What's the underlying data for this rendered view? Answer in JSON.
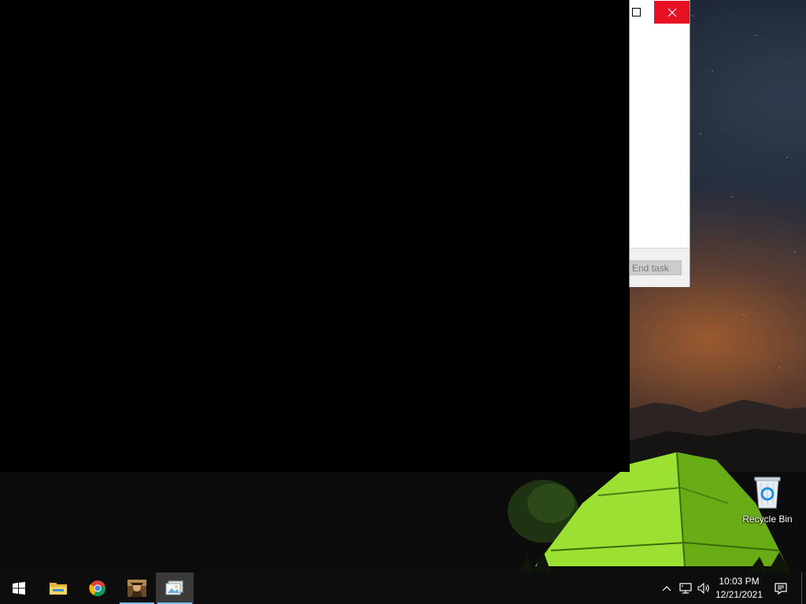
{
  "window": {
    "maximize_label": "Maximize",
    "close_label": "Close",
    "end_task_label": "End task"
  },
  "desktop": {
    "recycle_bin_label": "Recycle Bin"
  },
  "taskbar": {
    "start_icon": "windows-logo-icon",
    "pinned": [
      {
        "name": "file-explorer",
        "icon": "folder-icon",
        "running": false
      },
      {
        "name": "chrome",
        "icon": "chrome-icon",
        "running": false
      },
      {
        "name": "game-app",
        "icon": "character-portrait-icon",
        "running": true
      },
      {
        "name": "photos-app",
        "icon": "photos-icon",
        "running": true,
        "selected": true
      }
    ],
    "tray": {
      "chevron_icon": "chevron-up-icon",
      "network_icon": "network-icon",
      "volume_icon": "speaker-icon",
      "notifications_icon": "action-center-icon"
    },
    "clock": {
      "time": "10:03 PM",
      "date": "12/21/2021"
    }
  },
  "colors": {
    "close_button": "#e81123",
    "taskbar": "#0d0d0d",
    "active_underline": "#76b9ed"
  }
}
